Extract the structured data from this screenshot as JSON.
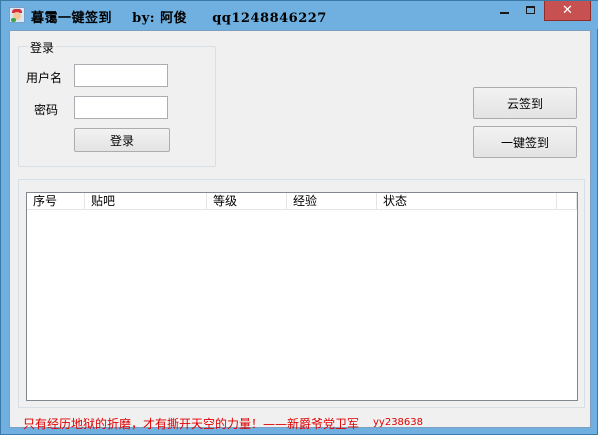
{
  "window": {
    "title": "暮霭一键签到    by: 阿俊     qq1248846227",
    "controls": {
      "minimize_icon": "minimize-icon",
      "maximize_icon": "maximize-icon",
      "close_icon": "close-icon",
      "close_glyph": "✕"
    },
    "accent": "#6fb0e0",
    "close_color": "#c75050"
  },
  "login": {
    "group_title": "登录",
    "username_label": "用户名",
    "username_value": "",
    "password_label": "密码",
    "password_value": "",
    "login_button": "登录"
  },
  "actions": {
    "cloud_sign_button": "云签到",
    "one_click_sign_button": "一键签到"
  },
  "list": {
    "columns": [
      "序号",
      "贴吧",
      "等级",
      "经验",
      "状态"
    ],
    "rows": []
  },
  "footer": {
    "motto": "只有经历地狱的折磨，才有撕开天空的力量！——新爵爷党卫军",
    "id": "yy238638",
    "text_color": "#e00000"
  }
}
